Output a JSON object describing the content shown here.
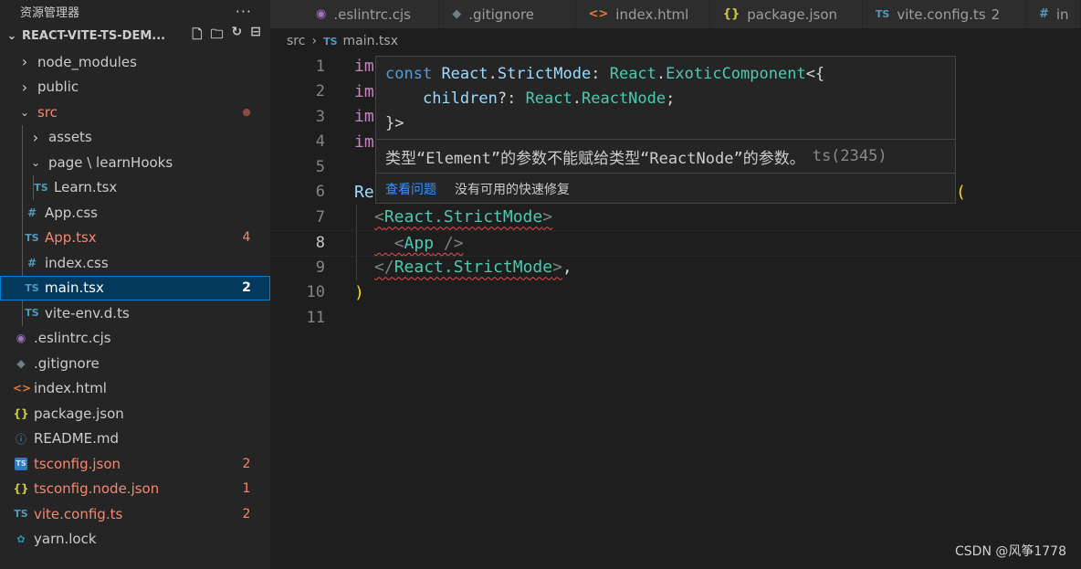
{
  "explorer": {
    "title": "资源管理器",
    "more": "···",
    "project": "REACT-VITE-TS-DEM...",
    "items": [
      {
        "label": "node_modules",
        "type": "folder",
        "state": "closed"
      },
      {
        "label": "public",
        "type": "folder",
        "state": "closed"
      },
      {
        "label": "src",
        "type": "folder",
        "state": "open",
        "badge": "●"
      },
      {
        "label": "assets",
        "type": "folder",
        "state": "closed"
      },
      {
        "label": "page \\ learnHooks",
        "type": "folder",
        "state": "open"
      },
      {
        "label": "Learn.tsx",
        "type": "ts"
      },
      {
        "label": "App.css",
        "type": "css"
      },
      {
        "label": "App.tsx",
        "type": "ts",
        "badge": "4"
      },
      {
        "label": "index.css",
        "type": "css"
      },
      {
        "label": "main.tsx",
        "type": "ts",
        "badge": "2"
      },
      {
        "label": "vite-env.d.ts",
        "type": "ts"
      },
      {
        "label": ".eslintrc.cjs",
        "type": "eslint"
      },
      {
        "label": ".gitignore",
        "type": "git"
      },
      {
        "label": "index.html",
        "type": "html"
      },
      {
        "label": "package.json",
        "type": "json"
      },
      {
        "label": "README.md",
        "type": "info"
      },
      {
        "label": "tsconfig.json",
        "type": "tsconfig",
        "badge": "2"
      },
      {
        "label": "tsconfig.node.json",
        "type": "json",
        "badge": "1"
      },
      {
        "label": "vite.config.ts",
        "type": "ts",
        "badge": "2"
      },
      {
        "label": "yarn.lock",
        "type": "yarn"
      }
    ]
  },
  "icons": {
    "chevron_right": "›",
    "chevron_down": "⌄",
    "ts": "TS",
    "css": "#",
    "json": "{}",
    "html": "<>",
    "eslint": "◉",
    "git": "◆",
    "info": "ⓘ",
    "yarn": "🧶"
  },
  "tabs": [
    {
      "label": ".eslintrc.cjs",
      "icon": "eslint"
    },
    {
      "label": ".gitignore",
      "icon": "git"
    },
    {
      "label": "index.html",
      "icon": "html"
    },
    {
      "label": "package.json",
      "icon": "json"
    },
    {
      "label": "vite.config.ts",
      "icon": "ts",
      "badge": "2"
    },
    {
      "label": "in",
      "icon": "css"
    }
  ],
  "breadcrumb": {
    "folder": "src",
    "sep": "›",
    "file": "main.tsx"
  },
  "editor": {
    "line_numbers": [
      "1",
      "2",
      "3",
      "4",
      "5",
      "6",
      "7",
      "8",
      "9",
      "10",
      "11"
    ],
    "lines": {
      "l1": "im",
      "l2": "im",
      "l3": "im",
      "l4": "im",
      "l6": "Re",
      "l6_paren": "(",
      "l7_open": "<",
      "l7_tag": "React.StrictMode",
      "l7_close": ">",
      "l8_open": "<",
      "l8_tag": "App",
      "l8_close": " />",
      "l9_open": "</",
      "l9_tag": "React.StrictMode",
      "l9_close": ">",
      "l9_comma": ",",
      "l10": ")"
    }
  },
  "hover": {
    "kw_const": "const",
    "name": "React",
    "dot": ".",
    "member": "StrictMode",
    "colon": ": ",
    "type_ns": "React",
    "type_name": "ExoticComponent",
    "open": "<{",
    "prop": "children",
    "optional": "?: ",
    "prop_type_ns": "React",
    "prop_type": "ReactNode",
    "semi": ";",
    "end": "}>",
    "message": "类型“Element”的参数不能赋给类型“ReactNode”的参数。",
    "code": "ts(2345)",
    "action_view": "查看问题",
    "action_nofix": "没有可用的快速修复"
  },
  "watermark": "CSDN @风筝1778",
  "colors": {
    "error": "#f48771",
    "accent": "#007fd4",
    "tag": "#4ec9b0",
    "keyword": "#c586c0"
  }
}
